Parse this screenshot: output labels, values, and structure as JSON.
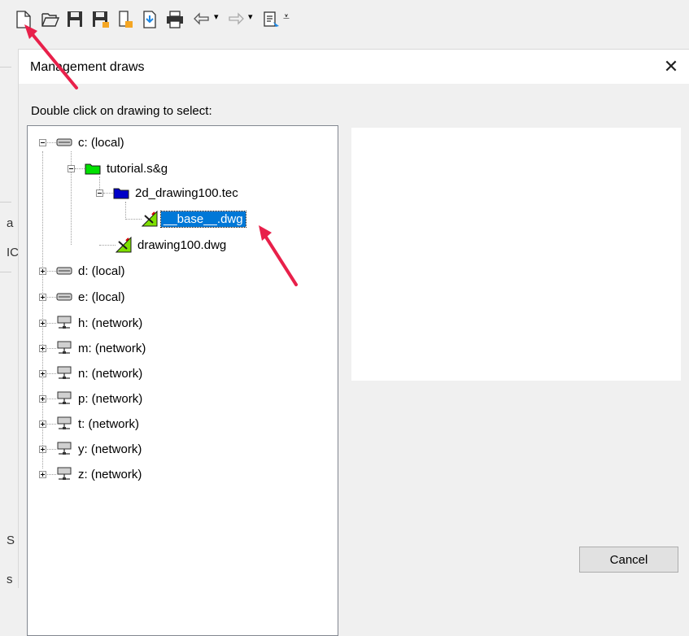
{
  "toolbar": {
    "icons": [
      "new-icon",
      "open-icon",
      "save-icon",
      "save-as-icon",
      "export-icon",
      "import-icon",
      "print-icon",
      "undo-icon",
      "redo-icon",
      "properties-icon",
      "overflow-icon"
    ]
  },
  "background": {
    "left_chars": [
      "a",
      "IC",
      "S",
      "s"
    ]
  },
  "dialog": {
    "title": "Management draws",
    "close_glyph": "✕",
    "instruction": "Double click on drawing to select:",
    "cancel_label": "Cancel"
  },
  "tree": {
    "nodes": [
      "c: (local)",
      "tutorial.s&g",
      "2d_drawing100.tec",
      "__base__.dwg",
      "drawing100.dwg",
      "d: (local)",
      "e: (local)",
      "h: (network)",
      "m: (network)",
      "n: (network)",
      "p: (network)",
      "t: (network)",
      "y: (network)",
      "z: (network)"
    ],
    "selected": "__base__.dwg"
  },
  "colors": {
    "selection": "#0078d7",
    "folder_green": "#00e000",
    "folder_blue": "#0000c8",
    "arrow": "#e8204a"
  }
}
